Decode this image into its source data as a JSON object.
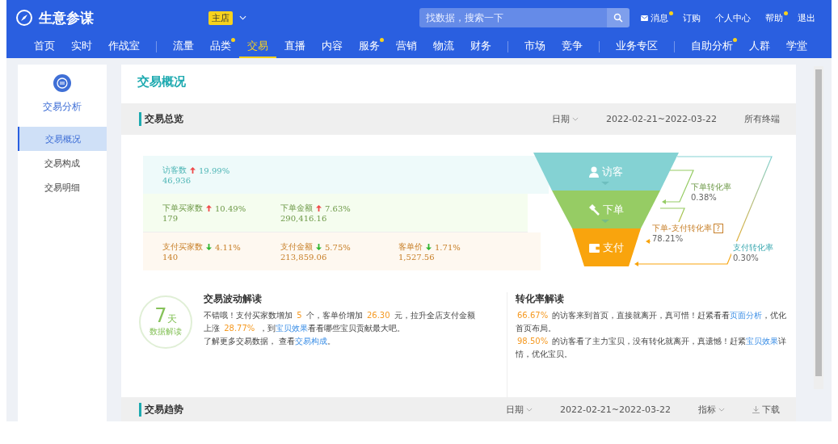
{
  "header": {
    "logo_text": "生意参谋",
    "store_badge": "主店",
    "search": {
      "placeholder": "找数据，搜索一下"
    },
    "top_links": [
      {
        "label": "消息",
        "dot": true
      },
      {
        "label": "订购",
        "dot": false
      },
      {
        "label": "个人中心",
        "dot": false
      },
      {
        "label": "帮助",
        "dot": true
      },
      {
        "label": "退出",
        "dot": false
      }
    ],
    "nav": [
      {
        "label": "首页",
        "selected": false,
        "dot": false,
        "divider_before": false
      },
      {
        "label": "实时",
        "selected": false,
        "dot": false,
        "divider_before": false
      },
      {
        "label": "作战室",
        "selected": false,
        "dot": false,
        "divider_before": false
      },
      {
        "label": "流量",
        "selected": false,
        "dot": false,
        "divider_before": true
      },
      {
        "label": "品类",
        "selected": false,
        "dot": true,
        "divider_before": false
      },
      {
        "label": "交易",
        "selected": true,
        "dot": false,
        "divider_before": false
      },
      {
        "label": "直播",
        "selected": false,
        "dot": false,
        "divider_before": false
      },
      {
        "label": "内容",
        "selected": false,
        "dot": false,
        "divider_before": false
      },
      {
        "label": "服务",
        "selected": false,
        "dot": true,
        "divider_before": false
      },
      {
        "label": "营销",
        "selected": false,
        "dot": false,
        "divider_before": false
      },
      {
        "label": "物流",
        "selected": false,
        "dot": false,
        "divider_before": false
      },
      {
        "label": "财务",
        "selected": false,
        "dot": false,
        "divider_before": false
      },
      {
        "label": "市场",
        "selected": false,
        "dot": false,
        "divider_before": true
      },
      {
        "label": "竞争",
        "selected": false,
        "dot": false,
        "divider_before": false
      },
      {
        "label": "业务专区",
        "selected": false,
        "dot": false,
        "divider_before": true
      },
      {
        "label": "自助分析",
        "selected": false,
        "dot": true,
        "divider_before": true
      },
      {
        "label": "人群",
        "selected": false,
        "dot": false,
        "divider_before": false
      },
      {
        "label": "学堂",
        "selected": false,
        "dot": false,
        "divider_before": false
      }
    ]
  },
  "sidebar": {
    "title": "交易分析",
    "items": [
      {
        "label": "交易概况",
        "selected": true
      },
      {
        "label": "交易构成",
        "selected": false
      },
      {
        "label": "交易明细",
        "selected": false
      }
    ]
  },
  "page_title": "交易概况",
  "overview": {
    "title": "交易总览",
    "date_label": "日期",
    "date_range": "2022-02-21~2022-03-22",
    "terminal": "所有终端",
    "metric_rows": [
      {
        "kind": "visit",
        "metrics": [
          {
            "label": "访客数",
            "rising": true,
            "change": "19.99%",
            "value": "46,936"
          }
        ]
      },
      {
        "kind": "order",
        "metrics": [
          {
            "label": "下单买家数",
            "rising": true,
            "change": "10.49%",
            "value": "179"
          },
          {
            "label": "下单金额",
            "rising": true,
            "change": "7.63%",
            "value": "290,416.16"
          }
        ]
      },
      {
        "kind": "pay",
        "metrics": [
          {
            "label": "支付买家数",
            "rising": false,
            "change": "4.11%",
            "value": "140"
          },
          {
            "label": "支付金额",
            "rising": false,
            "change": "5.75%",
            "value": "213,859.06"
          },
          {
            "label": "客单价",
            "rising": false,
            "change": "1.71%",
            "value": "1,527.56"
          }
        ]
      }
    ],
    "funnel": [
      {
        "kind": "visit",
        "label": "访客"
      },
      {
        "kind": "order",
        "label": "下单"
      },
      {
        "kind": "pay",
        "label": "支付"
      }
    ],
    "rates": [
      {
        "kind": "order",
        "label": "下单转化率",
        "value": "0.38%"
      },
      {
        "kind": "order_pay",
        "label": "下单-支付转化率",
        "value": "78.21%",
        "help": "?"
      },
      {
        "kind": "pay",
        "label": "支付转化率",
        "value": "0.30%"
      }
    ]
  },
  "insights": {
    "badge": {
      "number": "7",
      "unit": "天",
      "caption": "数据解读"
    },
    "blocks": [
      {
        "title": "交易波动解读",
        "lines": [
          [
            {
              "kind": "text",
              "text": "不错哦！支付买家数增加 "
            },
            {
              "kind": "num",
              "text": "5"
            },
            {
              "kind": "text",
              "text": " 个，客单价增加 "
            },
            {
              "kind": "num",
              "text": "26.30"
            },
            {
              "kind": "text",
              "text": " 元，拉升全店支付金额上涨 "
            },
            {
              "kind": "num",
              "text": "28.77%"
            },
            {
              "kind": "text",
              "text": " ，到"
            },
            {
              "kind": "link",
              "text": "宝贝效果"
            },
            {
              "kind": "text",
              "text": "看看哪些宝贝贡献最大吧。"
            }
          ],
          [
            {
              "kind": "text",
              "text": "了解更多交易数据，  查看"
            },
            {
              "kind": "link",
              "text": "交易构成"
            },
            {
              "kind": "text",
              "text": "。"
            }
          ]
        ]
      },
      {
        "title": "转化率解读",
        "lines": [
          [
            {
              "kind": "num",
              "text": "66.67%"
            },
            {
              "kind": "text",
              "text": " 的访客来到首页，直接就离开，真可惜！赶紧看看"
            },
            {
              "kind": "link",
              "text": "页面分析"
            },
            {
              "kind": "text",
              "text": "，优化首页布局。"
            }
          ],
          [
            {
              "kind": "num",
              "text": "98.50%"
            },
            {
              "kind": "text",
              "text": " 的访客看了主力宝贝，没有转化就离开，真遗憾！赶紧"
            },
            {
              "kind": "link",
              "text": "宝贝效果"
            },
            {
              "kind": "text",
              "text": "详情，优化宝贝。"
            }
          ]
        ]
      }
    ]
  },
  "trend": {
    "title": "交易趋势",
    "date_label": "日期",
    "date_range": "2022-02-21~2022-03-22",
    "metric_label": "指标",
    "download": "下载"
  }
}
